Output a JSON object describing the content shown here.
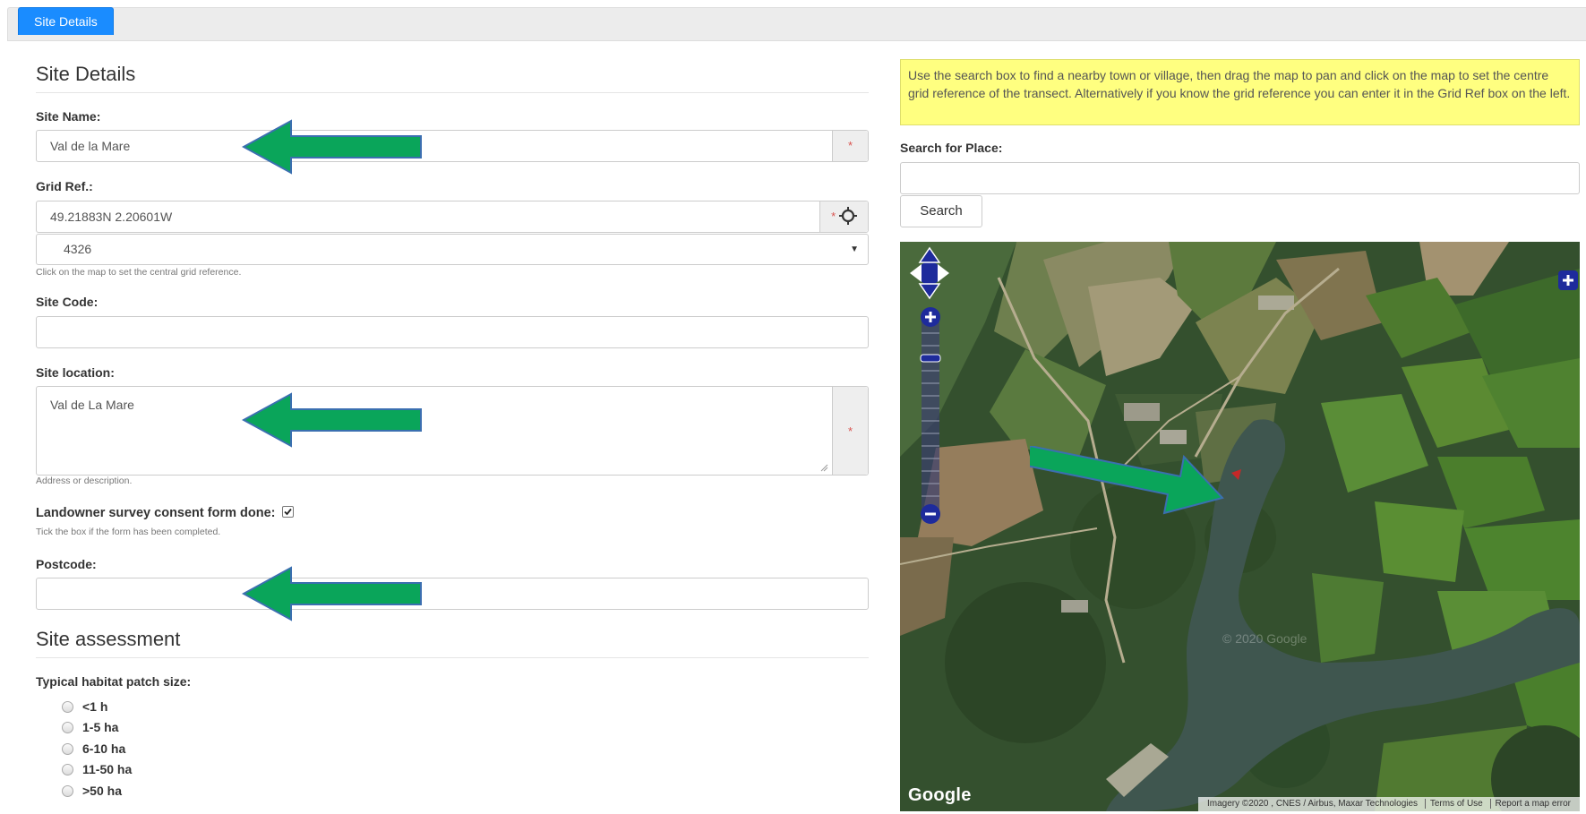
{
  "tabs": [
    {
      "label": "Site Details",
      "active": true
    }
  ],
  "site_details": {
    "title": "Site Details",
    "site_name": {
      "label": "Site Name:",
      "value": "Val de la Mare",
      "required_marker": "*"
    },
    "grid_ref": {
      "label": "Grid Ref.:",
      "value": "49.21883N 2.20601W",
      "required_marker": "*",
      "system_value": "4326",
      "help": "Click on the map to set the central grid reference."
    },
    "site_code": {
      "label": "Site Code:",
      "value": ""
    },
    "site_location": {
      "label": "Site location:",
      "value": "Val de La Mare",
      "required_marker": "*",
      "help": "Address or description."
    },
    "consent": {
      "label": "Landowner survey consent form done:",
      "checked": true,
      "help": "Tick the box if the form has been completed."
    },
    "postcode": {
      "label": "Postcode:",
      "value": ""
    }
  },
  "site_assessment": {
    "title": "Site assessment",
    "patch_size": {
      "label": "Typical habitat patch size:",
      "options": [
        "<1 h",
        "1-5 ha",
        "6-10 ha",
        "11-50 ha",
        ">50 ha"
      ]
    }
  },
  "map_panel": {
    "notice": "Use the search box to find a nearby town or village, then drag the map to pan and click on the map to set the centre grid reference of the transect. Alternatively if you know the grid reference you can enter it in the Grid Ref box on the left.",
    "search_label": "Search for Place:",
    "search_value": "",
    "search_button": "Search",
    "logo": "Google",
    "attribution": "Imagery ©2020 , CNES / Airbus, Maxar Technologies",
    "terms": "Terms of Use",
    "report": "Report a map error",
    "watermark": "© 2020 Google"
  },
  "colors": {
    "accent": "#1a8cff",
    "annotation_arrow": "#0aa55a",
    "required": "#d9534f",
    "notice_bg": "#ffff80"
  },
  "icons": {
    "locate": "crosshair-icon",
    "pan": "pan-arrows-icon",
    "zoom_in": "zoom-in-icon",
    "zoom_out": "zoom-out-icon"
  }
}
